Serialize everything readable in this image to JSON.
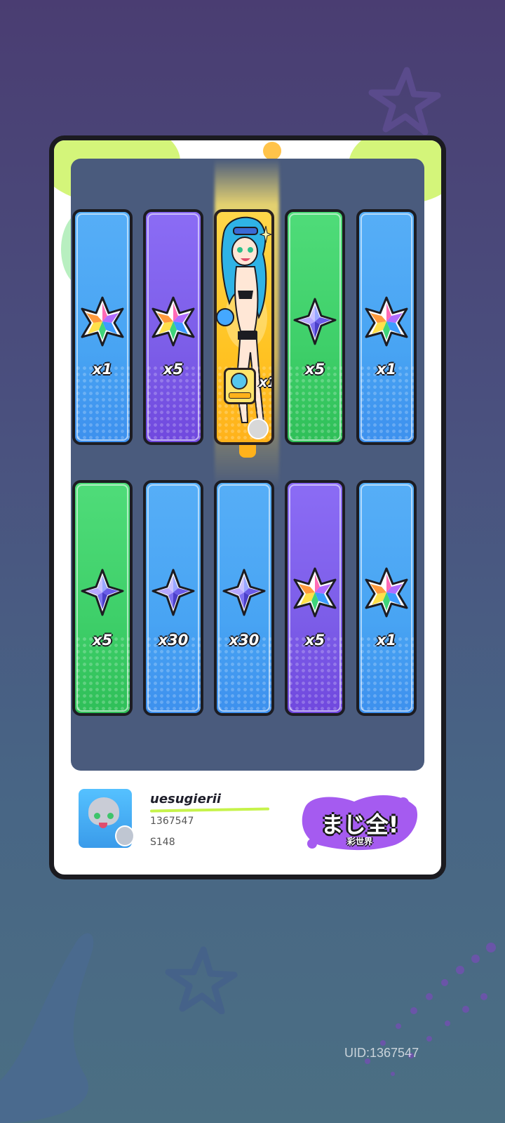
{
  "rewards": [
    {
      "color": "#48a4f3",
      "gem": "rainbow-star-gem",
      "qty": "x1"
    },
    {
      "color": "#7c5de8",
      "gem": "rainbow-star-gem",
      "qty": "x5"
    },
    {
      "color": "#ffc323",
      "gem": "character-card",
      "qty": "x1",
      "featured": true
    },
    {
      "color": "#3ecf69",
      "gem": "purple-crystal-gem",
      "qty": "x5"
    },
    {
      "color": "#48a4f3",
      "gem": "rainbow-star-gem",
      "qty": "x1"
    },
    {
      "color": "#3ecf69",
      "gem": "purple-crystal-gem",
      "qty": "x5"
    },
    {
      "color": "#48a4f3",
      "gem": "purple-crystal-gem",
      "qty": "x30"
    },
    {
      "color": "#48a4f3",
      "gem": "purple-crystal-gem",
      "qty": "x30"
    },
    {
      "color": "#7c5de8",
      "gem": "rainbow-star-gem",
      "qty": "x5"
    },
    {
      "color": "#48a4f3",
      "gem": "rainbow-star-gem",
      "qty": "x1"
    }
  ],
  "player": {
    "username": "uesugierii",
    "uid": "1367547",
    "server": "S148"
  },
  "logo": {
    "title": "まじ全!",
    "subtitle": "彩世界"
  },
  "footer": {
    "uid_label": "UID:1367547"
  }
}
